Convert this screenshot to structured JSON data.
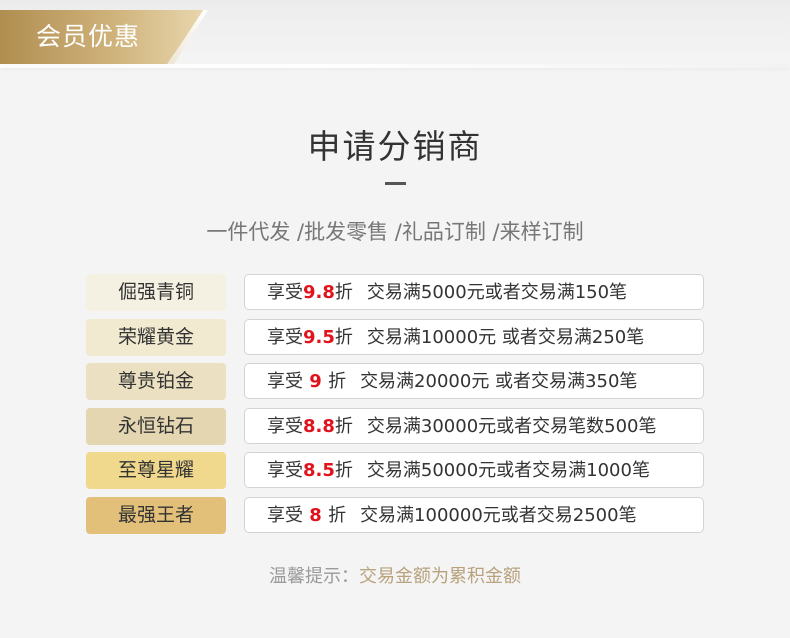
{
  "banner": {
    "label": "会员优惠"
  },
  "title": "申请分销商",
  "subtitle": "一件代发 /批发零售 /礼品订制 /来样订制",
  "tiers": [
    {
      "name": "倔强青铜",
      "prefix": "享受",
      "discount": "9.8",
      "suffix": "折",
      "condition": "交易满5000元或者交易满150笔",
      "color": "#f5f1e2"
    },
    {
      "name": "荣耀黄金",
      "prefix": "享受",
      "discount": "9.5",
      "suffix": "折",
      "condition": "交易满10000元 或者交易满250笔",
      "color": "#f1ead1"
    },
    {
      "name": "尊贵铂金",
      "prefix": "享受",
      "discount": " 9 ",
      "suffix": "折",
      "condition": "交易满20000元 或者交易满350笔",
      "color": "#ebe0c2"
    },
    {
      "name": "永恒钻石",
      "prefix": "享受",
      "discount": "8.8",
      "suffix": "折",
      "condition": "交易满30000元或者交易笔数500笔",
      "color": "#e3d6b1"
    },
    {
      "name": "至尊星耀",
      "prefix": "享受",
      "discount": "8.5",
      "suffix": "折",
      "condition": "交易满50000元或者交易满1000笔",
      "color": "#f0d98c"
    },
    {
      "name": "最强王者",
      "prefix": "享受",
      "discount": " 8 ",
      "suffix": "折",
      "condition": "交易满100000元或者交易2500笔",
      "color": "#e2c07a"
    }
  ],
  "tip": {
    "label": "温馨提示：",
    "text": "交易金额为累积金额"
  },
  "colors": {
    "banner_gold": "#c2a268",
    "discount_red": "#e0131d",
    "tip_gold": "#b7a27c"
  }
}
